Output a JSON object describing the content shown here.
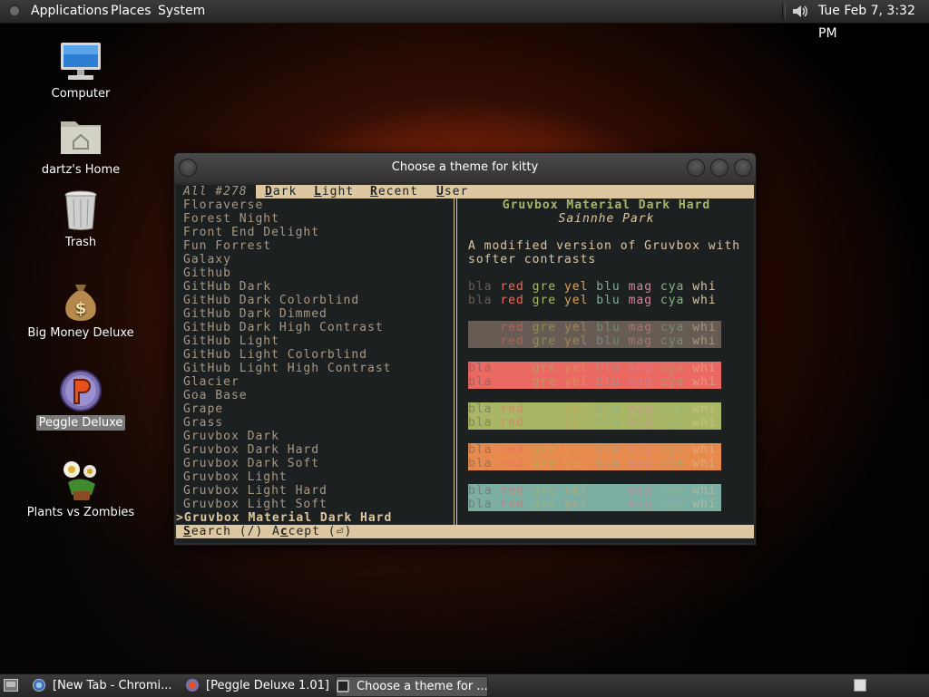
{
  "top_panel": {
    "menus": [
      "Applications",
      "Places",
      "System"
    ],
    "clock": "Tue Feb  7,  3:32 PM",
    "icons": {
      "logo": "distro-logo-icon",
      "volume": "speaker-icon"
    }
  },
  "desktop_icons": [
    {
      "label": "Computer",
      "icon": "computer-icon"
    },
    {
      "label": "dartz's Home",
      "icon": "home-folder-icon"
    },
    {
      "label": "Trash",
      "icon": "trash-icon"
    },
    {
      "label": "Big Money Deluxe",
      "icon": "money-bag-icon"
    },
    {
      "label": "Peggle Deluxe",
      "icon": "peggle-icon",
      "selected": true
    },
    {
      "label": "Plants vs Zombies",
      "icon": "flower-icon"
    }
  ],
  "window": {
    "title": "Choose a theme for kitty",
    "tabs": {
      "all": "All #278",
      "dark_key": "D",
      "dark_rest": "ark",
      "light_key": "L",
      "light_rest": "ight",
      "recent_key": "R",
      "recent_rest": "ecent",
      "user_key": "U",
      "user_rest": "ser"
    },
    "themes": [
      "Floraverse",
      "Forest Night",
      "Front End Delight",
      "Fun Forrest",
      "Galaxy",
      "Github",
      "GitHub Dark",
      "GitHub Dark Colorblind",
      "GitHub Dark Dimmed",
      "GitHub Dark High Contrast",
      "GitHub Light",
      "GitHub Light Colorblind",
      "GitHub Light High Contrast",
      "Glacier",
      "Goa Base",
      "Grape",
      "Grass",
      "Gruvbox Dark",
      "Gruvbox Dark Hard",
      "Gruvbox Dark Soft",
      "Gruvbox Light",
      "Gruvbox Light Hard",
      "Gruvbox Light Soft"
    ],
    "selected_theme": ">Gruvbox Material Dark Hard",
    "preview": {
      "name": "Gruvbox Material Dark Hard",
      "author": "Sainnhe Park",
      "description": "A modified version of Gruvbox with softer contrasts",
      "color_row": "bla red gre yel blu mag cya whi",
      "colors": {
        "bla": "#665c54",
        "red": "#ea6962",
        "gre": "#a9b665",
        "yel": "#d8a657",
        "blu": "#7daea3",
        "mag": "#d3869b",
        "cya": "#89b482",
        "whi": "#ddc7a1",
        "bg": "#1d2021",
        "fg": "#ddc7a1",
        "orange": "#e78a4e"
      }
    },
    "status": {
      "search_key": "S",
      "search_rest": "earch (/)",
      "accept_pre": "A",
      "accept_key": "c",
      "accept_rest": "cept (⏎)"
    }
  },
  "taskbar": {
    "show_desktop_icon": "show-desktop-icon",
    "tasks": [
      {
        "label": "[New Tab - Chromi...",
        "icon": "chromium-icon"
      },
      {
        "label": "[Peggle Deluxe 1.01]",
        "icon": "peggle-icon"
      },
      {
        "label": "Choose a theme for ...",
        "icon": "terminal-icon",
        "active": true
      }
    ],
    "workspace_icon": "workspace-switcher-icon"
  }
}
